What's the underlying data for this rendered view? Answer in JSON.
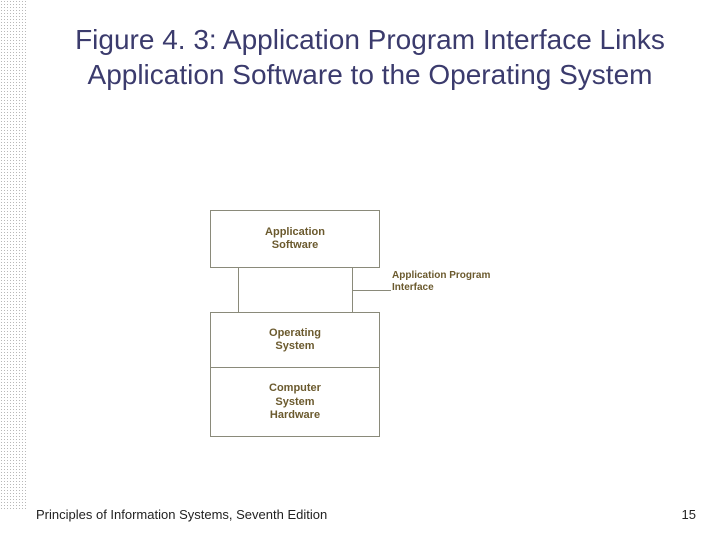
{
  "title": "Figure 4. 3: Application Program Interface Links Application Software to the Operating System",
  "diagram": {
    "app_box_l1": "Application",
    "app_box_l2": "Software",
    "os_box_l1": "Operating",
    "os_box_l2": "System",
    "hw_box_l1": "Computer",
    "hw_box_l2": "System",
    "hw_box_l3": "Hardware",
    "api_label_l1": "Application Program",
    "api_label_l2": "Interface"
  },
  "footer": {
    "left": "Principles of Information Systems, Seventh Edition",
    "page": "15"
  }
}
